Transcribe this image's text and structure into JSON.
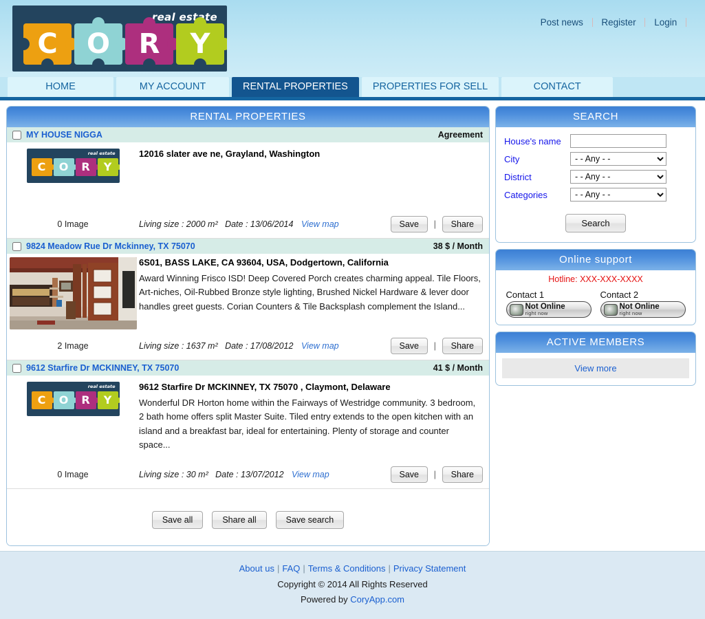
{
  "header": {
    "logo": {
      "tagline": "real estate",
      "letters": [
        {
          "char": "C",
          "color": "#eda011"
        },
        {
          "char": "O",
          "color": "#8fd3d4"
        },
        {
          "char": "R",
          "color": "#ad2f7e"
        },
        {
          "char": "Y",
          "color": "#b2cc1f"
        }
      ],
      "background": "#23445e"
    },
    "top_links": [
      {
        "label": "Post news"
      },
      {
        "label": "Register"
      },
      {
        "label": "Login"
      }
    ]
  },
  "nav": {
    "tabs": [
      {
        "label": "HOME",
        "active": false
      },
      {
        "label": "MY ACCOUNT",
        "active": false
      },
      {
        "label": "RENTAL PROPERTIES",
        "active": true
      },
      {
        "label": "PROPERTIES FOR SELL",
        "active": false
      },
      {
        "label": "CONTACT",
        "active": false
      }
    ]
  },
  "main": {
    "panel_title": "RENTAL PROPERTIES",
    "listings": [
      {
        "title": "MY HOUSE NIGGA",
        "right_label": "Agreement",
        "address": "12016 slater ave ne, Grayland, Washington",
        "description": "",
        "image_count": "0 Image",
        "living_size": "Living size : 2000 m²",
        "date": "Date : 13/06/2014",
        "map_link": "View map",
        "save_label": "Save",
        "share_label": "Share",
        "thumb_type": "logo"
      },
      {
        "title": "9824 Meadow Rue Dr Mckinney, TX 75070",
        "right_label": "38 $ / Month",
        "address": "6S01, BASS LAKE, CA 93604, USA, Dodgertown, California",
        "description": "Award Winning Frisco ISD! Deep Covered Porch creates charming appeal. Tile Floors, Art-niches, Oil-Rubbed Bronze style lighting, Brushed Nickel Hardware & lever door handles greet guests. Corian Counters & Tile Backsplash complement the Island...",
        "image_count": "2 Image",
        "living_size": "Living size : 1637 m²",
        "date": "Date : 17/08/2012",
        "map_link": "View map",
        "save_label": "Save",
        "share_label": "Share",
        "thumb_type": "photo"
      },
      {
        "title": "9612 Starfire Dr MCKINNEY, TX 75070",
        "right_label": "41 $ / Month",
        "address": "9612 Starfire Dr MCKINNEY, TX 75070 , Claymont, Delaware",
        "description": "Wonderful DR Horton home within the Fairways of Westridge community. 3 bedroom, 2 bath home offers split Master Suite. Tiled entry extends to the open kitchen with an island and a breakfast bar, ideal for entertaining. Plenty of storage and counter space...",
        "image_count": "0 Image",
        "living_size": "Living size : 30 m²",
        "date": "Date : 13/07/2012",
        "map_link": "View map",
        "save_label": "Save",
        "share_label": "Share",
        "thumb_type": "logo"
      }
    ],
    "bottom_actions": [
      {
        "label": "Save all"
      },
      {
        "label": "Share all"
      },
      {
        "label": "Save search"
      }
    ]
  },
  "sidebar": {
    "search": {
      "title": "SEARCH",
      "fields": [
        {
          "label": "House's name",
          "type": "text",
          "value": "",
          "placeholder": ""
        },
        {
          "label": "City",
          "type": "select",
          "value": "- - Any - -"
        },
        {
          "label": "District",
          "type": "select",
          "value": "- - Any - -"
        },
        {
          "label": "Categories",
          "type": "select",
          "value": "- - Any - -"
        }
      ],
      "button_label": "Search"
    },
    "support": {
      "title": "Online support",
      "hotline": "Hotline: XXX-XXX-XXXX",
      "contacts": [
        {
          "name": "Contact 1",
          "status_line1": "Not Online",
          "status_line2": "right now"
        },
        {
          "name": "Contact 2",
          "status_line1": "Not Online",
          "status_line2": "right now"
        }
      ]
    },
    "members": {
      "title": "ACTIVE MEMBERS",
      "view_more": "View more"
    }
  },
  "footer": {
    "links": [
      {
        "label": "About us"
      },
      {
        "label": "FAQ"
      },
      {
        "label": "Terms & Conditions"
      },
      {
        "label": "Privacy Statement"
      }
    ],
    "copyright": "Copyright © 2014 All Rights Reserved",
    "powered_prefix": "Powered by ",
    "powered_link": "CoryApp.com"
  }
}
